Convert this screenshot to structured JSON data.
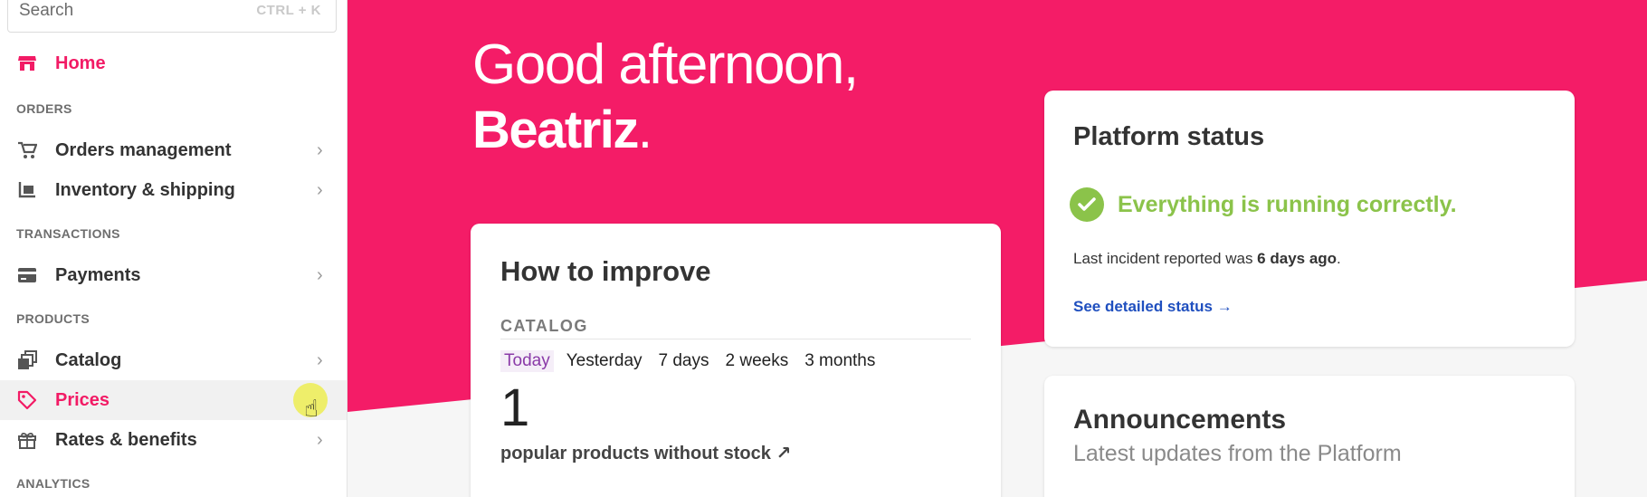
{
  "search": {
    "placeholder": "Search",
    "shortcut": "CTRL + K"
  },
  "sidebar": {
    "home": {
      "label": "Home",
      "icon": "store-icon"
    },
    "sections": {
      "orders": "ORDERS",
      "transactions": "TRANSACTIONS",
      "products": "PRODUCTS",
      "analytics": "ANALYTICS"
    },
    "items": {
      "orders_management": {
        "label": "Orders management",
        "icon": "cart-icon"
      },
      "inventory_shipping": {
        "label": "Inventory & shipping",
        "icon": "dolly-icon"
      },
      "payments": {
        "label": "Payments",
        "icon": "card-icon"
      },
      "catalog": {
        "label": "Catalog",
        "icon": "layers-icon"
      },
      "prices": {
        "label": "Prices",
        "icon": "tag-icon"
      },
      "rates_benefits": {
        "label": "Rates & benefits",
        "icon": "gift-icon"
      }
    }
  },
  "greeting": {
    "line1": "Good afternoon,",
    "name": "Beatriz",
    "punct": "."
  },
  "improve": {
    "title": "How to improve",
    "section": "CATALOG",
    "tabs": [
      "Today",
      "Yesterday",
      "7 days",
      "2 weeks",
      "3 months"
    ],
    "selected_tab": "Today",
    "value": "1",
    "metric_label": "popular products without stock ↗"
  },
  "status": {
    "title": "Platform status",
    "ok_text": "Everything is running correctly.",
    "incident_prefix": "Last incident reported was ",
    "incident_time": "6 days ago",
    "incident_suffix": ".",
    "link": "See detailed status →"
  },
  "announcements": {
    "title": "Announcements",
    "subtitle": "Latest updates from the Platform"
  },
  "colors": {
    "brand": "#f41c67",
    "success": "#8bc34a",
    "link": "#1f4fbf"
  }
}
